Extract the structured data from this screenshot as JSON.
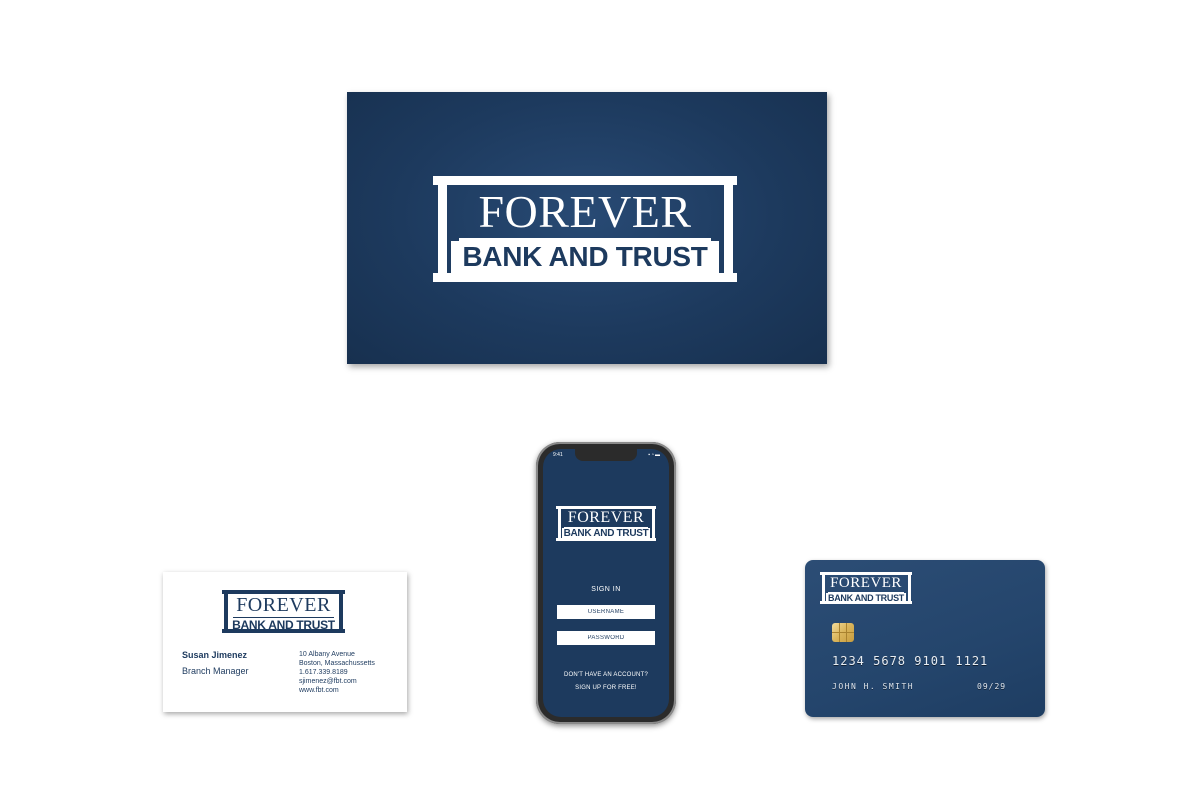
{
  "brand": {
    "name_top": "FOREVER",
    "name_bottom": "BANK AND TRUST",
    "navy": "#1d3a5e",
    "white": "#ffffff",
    "chip_gold": "#d9b45a"
  },
  "business_card": {
    "name": "Susan Jimenez",
    "title": "Branch Manager",
    "address_line1": "10 Albany Avenue",
    "address_line2": "Boston, Massachussetts",
    "phone": "1.617.339.8189",
    "email": "sjimenez@fbt.com",
    "website": "www.fbt.com"
  },
  "phone_app": {
    "status_time": "9:41",
    "status_icons": "signal-icon wifi-icon battery-icon",
    "sign_in_label": "SIGN IN",
    "username_placeholder": "USERNAME",
    "password_placeholder": "PASSWORD",
    "no_account_text": "DON'T HAVE AN ACCOUNT?",
    "signup_text": "SIGN UP FOR FREE!"
  },
  "credit_card": {
    "number": "1234  5678  9101  1121",
    "holder": "JOHN H. SMITH",
    "expiry": "09/29"
  }
}
